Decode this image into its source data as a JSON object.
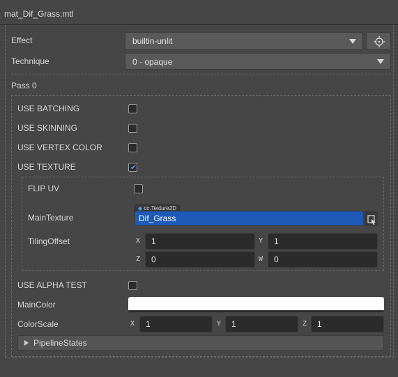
{
  "title": "mat_Dif_Grass.mtl",
  "effect": {
    "label": "Effect",
    "value": "builtin-unlit",
    "locate_icon": "crosshair-icon"
  },
  "technique": {
    "label": "Technique",
    "value": "0 - opaque"
  },
  "pass": {
    "label": "Pass 0"
  },
  "options": {
    "use_batching": {
      "label": "USE BATCHING",
      "checked": false
    },
    "use_skinning": {
      "label": "USE SKINNING",
      "checked": false
    },
    "use_vertex_color": {
      "label": "USE VERTEX COLOR",
      "checked": false
    },
    "use_texture": {
      "label": "USE TEXTURE",
      "checked": true
    },
    "flip_uv": {
      "label": "FLIP UV",
      "checked": false
    },
    "use_alpha_test": {
      "label": "USE ALPHA TEST",
      "checked": false
    }
  },
  "main_texture": {
    "label": "MainTexture",
    "type_tag": "cc.Texture2D",
    "value": "Dif_Grass",
    "icon": "asset-select-icon"
  },
  "tiling_offset": {
    "label": "TilingOffset",
    "x_label": "X",
    "x": "1",
    "y_label": "Y",
    "y": "1",
    "z_label": "Z",
    "z": "0",
    "w_label": "W",
    "w": "0"
  },
  "main_color": {
    "label": "MainColor",
    "value": "#ffffff"
  },
  "color_scale": {
    "label": "ColorScale",
    "x_label": "X",
    "x": "1",
    "y_label": "Y",
    "y": "1",
    "z_label": "Z",
    "z": "1"
  },
  "pipeline_states": {
    "label": "PipelineStates",
    "expanded": false
  }
}
